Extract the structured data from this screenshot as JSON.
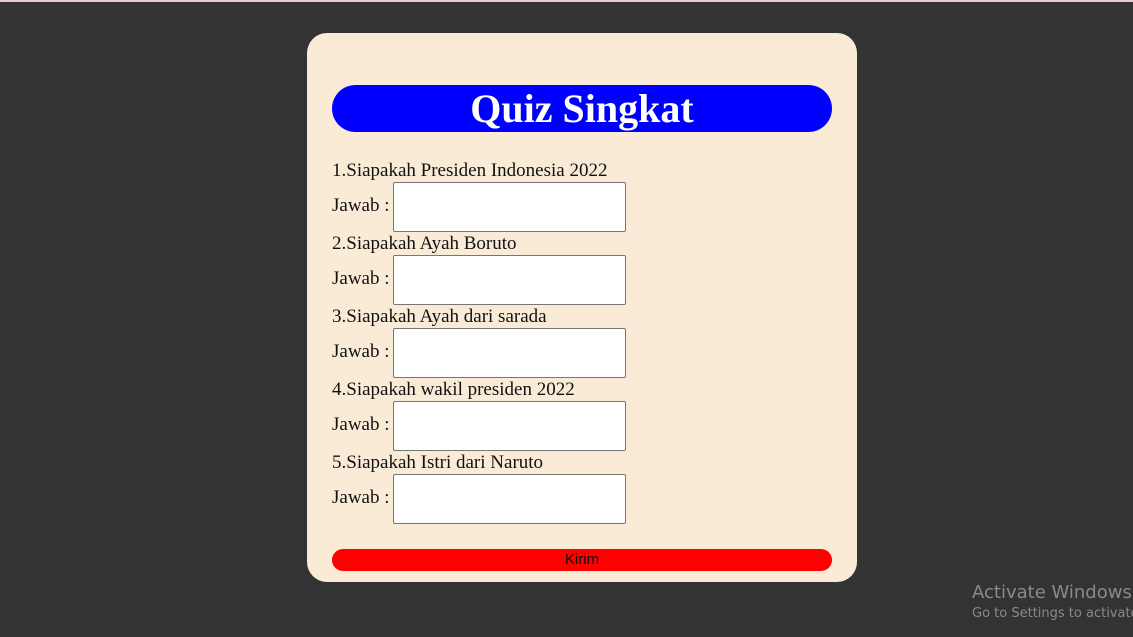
{
  "quiz": {
    "title": "Quiz Singkat",
    "answer_label": "Jawab :",
    "questions": [
      {
        "text": "1.Siapakah Presiden Indonesia 2022",
        "answer": ""
      },
      {
        "text": "2.Siapakah Ayah Boruto",
        "answer": ""
      },
      {
        "text": "3.Siapakah Ayah dari sarada",
        "answer": ""
      },
      {
        "text": "4.Siapakah wakil presiden 2022",
        "answer": ""
      },
      {
        "text": "5.Siapakah Istri dari Naruto",
        "answer": ""
      }
    ],
    "submit_label": "Kirim"
  },
  "watermark": {
    "title": "Activate Windows",
    "subtitle": "Go to Settings to activate Windows."
  },
  "colors": {
    "background": "#333333",
    "card": "#faebd7",
    "title_bg": "#0000ff",
    "title_text": "#ffffff",
    "submit_bg": "#ff0000"
  }
}
